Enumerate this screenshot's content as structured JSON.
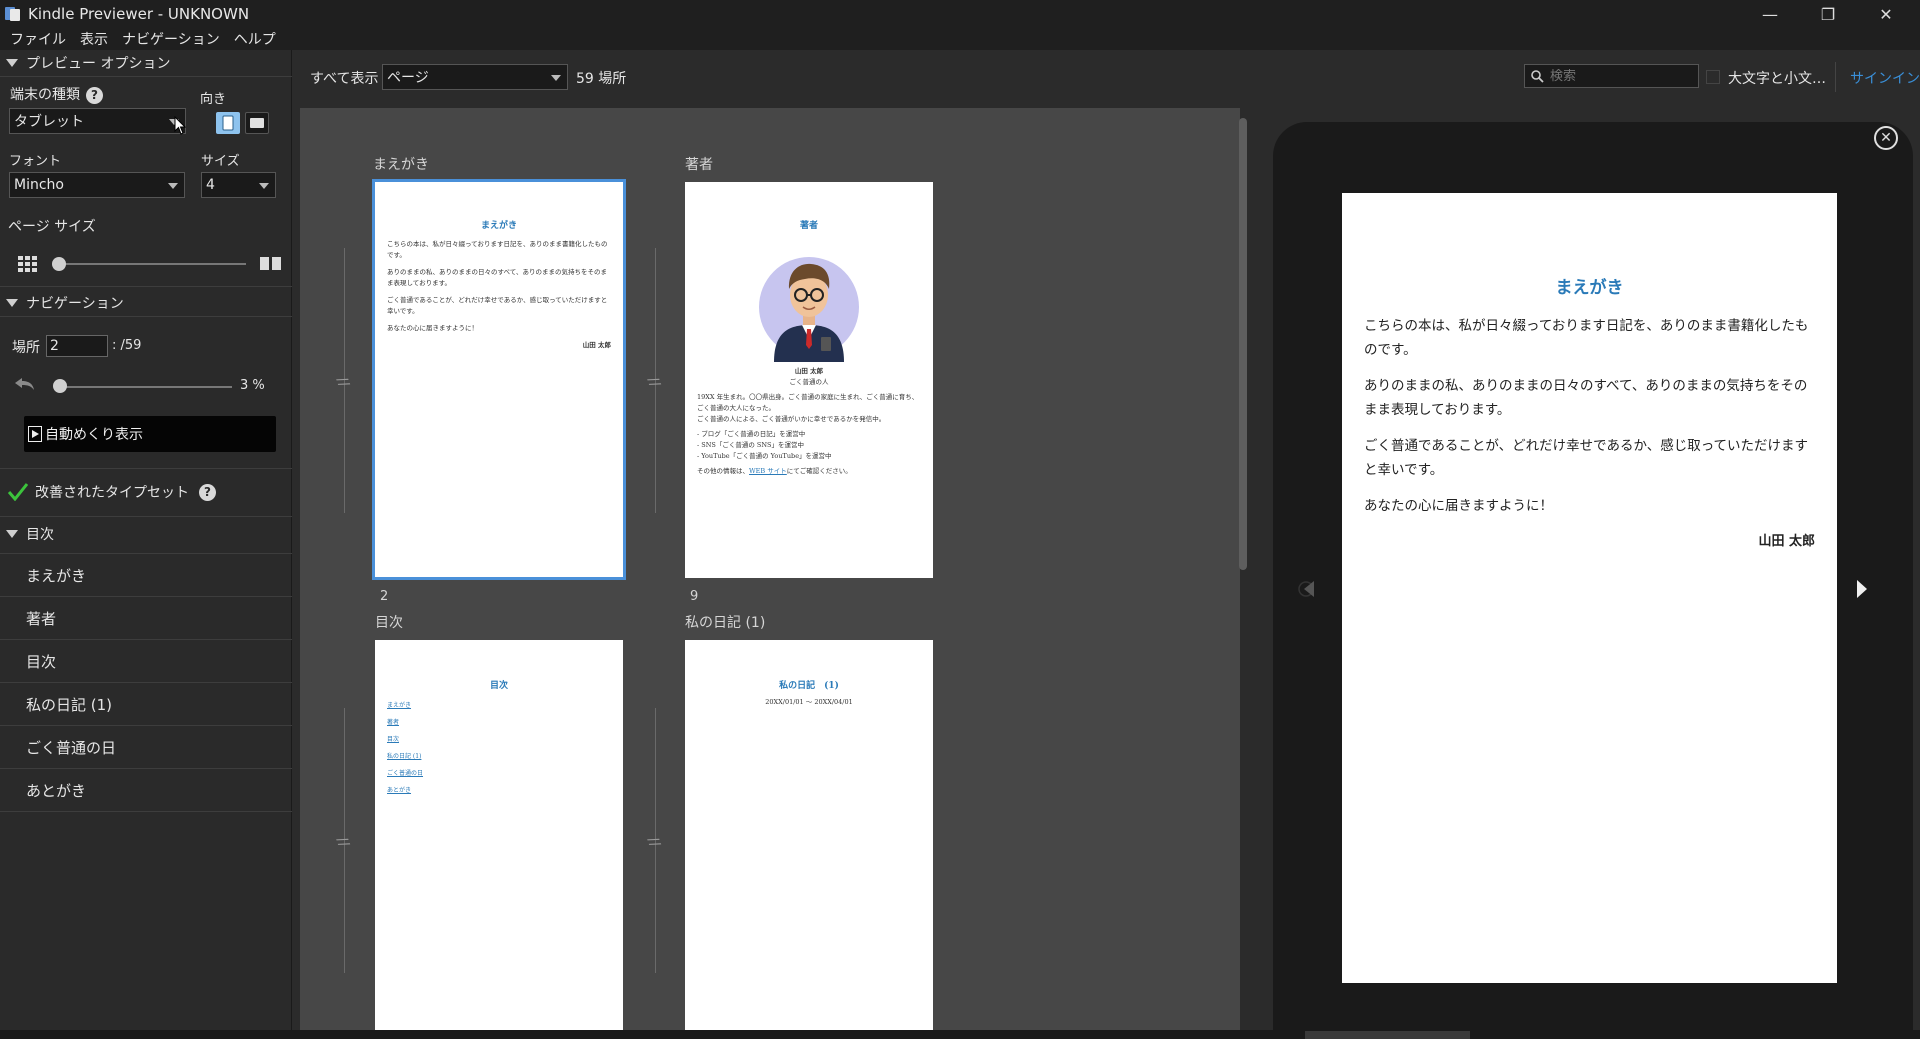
{
  "window": {
    "title": "Kindle Previewer - UNKNOWN",
    "minimize": "—",
    "restore": "❐",
    "close": "✕"
  },
  "menu": [
    "ファイル",
    "表示",
    "ナビゲーション",
    "ヘルプ"
  ],
  "sidebar": {
    "preview_options": {
      "header": "プレビュー オプション",
      "device_label": "端末の種類",
      "device_value": "タブレット",
      "orientation_label": "向き",
      "font_label": "フォント",
      "font_value": "Mincho",
      "size_label": "サイズ",
      "size_value": "4",
      "page_size_label": "ページ サイズ",
      "page_size_fraction": 0.0
    },
    "navigation": {
      "header": "ナビゲーション",
      "location_label": "場所",
      "location_value": "2",
      "location_total": ": /59",
      "progress_percent": "3 %",
      "progress_fraction": 0.03,
      "autoflip_label": "自動めくり表示"
    },
    "typeset": {
      "label": "改善されたタイプセット"
    },
    "toc": {
      "header": "目次",
      "items": [
        "まえがき",
        "著者",
        "目次",
        "私の日記 (1)",
        "ごく普通の日",
        "あとがき"
      ]
    }
  },
  "toolbar": {
    "show_all_label": "すべて表示",
    "view_mode": "ページ",
    "location_count": "59 場所",
    "search_placeholder": "検索",
    "match_case_label": "大文字と小文…",
    "signin_label": "サインイン"
  },
  "grid": {
    "pages": [
      {
        "section": "まえがき",
        "number": "2",
        "title": "まえがき",
        "paragraphs": [
          "こちらの本は、私が日々綴っております日記を、ありのまま書籍化したものです。",
          "ありのままの私、ありのままの日々のすべて、ありのままの気持ちをそのまま表現しております。",
          "ごく普通であることが、どれだけ幸せであるか、感じ取っていただけますと幸いです。",
          "あなたの心に届きますように！"
        ],
        "signature": "山田 太郎"
      },
      {
        "section": "著者",
        "number": "9",
        "title": "著者",
        "name": "山田 太郎",
        "subtitle": "ごく普通の人",
        "paragraphs": [
          "19XX 年生まれ。〇〇県出身。ごく普通の家庭に生まれ、ごく普通に育ち、ごく普通の大人になった。",
          "ごく普通の人による、ごく普通がいかに幸せであるかを発信中。"
        ],
        "bullets": [
          "- ブログ「ごく普通の日記」を運営中",
          "- SNS「ごく普通の SNS」を運営中",
          "- YouTube「ごく普通の YouTube」を運営中"
        ],
        "footer_prefix": "その他の情報は、",
        "footer_link": "WEB サイト",
        "footer_suffix": "にてご確認ください。"
      },
      {
        "section": "目次",
        "title": "目次",
        "links": [
          "まえがき",
          "著者",
          "目次",
          "私の日記 (1)",
          "ごく普通の日",
          "あとがき"
        ]
      },
      {
        "section": "私の日記 (1)",
        "title": "私の日記　(1)",
        "dates": "20XX/01/01 ～ 20XX/04/01"
      }
    ]
  },
  "preview": {
    "title": "まえがき",
    "paragraphs": [
      "こちらの本は、私が日々綴っております日記を、ありのまま書籍化したものです。",
      "ありのままの私、ありのままの日々のすべて、ありのままの気持ちをそのまま表現しております。",
      "ごく普通であることが、どれだけ幸せであるか、感じ取っていただけますと幸いです。",
      "あなたの心に届きますように！"
    ],
    "signature": "山田 太郎"
  },
  "colors": {
    "accent": "#4a90d9",
    "link_blue": "#2a7ab8",
    "check_green": "#3cc43c",
    "signin_blue": "#3a8fd8"
  }
}
